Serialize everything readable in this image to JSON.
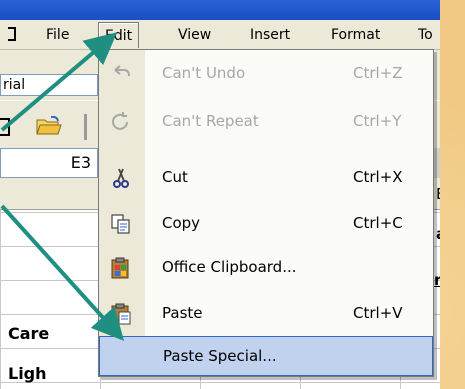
{
  "menubar": {
    "items": [
      {
        "id": "file",
        "label": "File",
        "u": "F"
      },
      {
        "id": "edit",
        "label": "Edit",
        "u": "E"
      },
      {
        "id": "view",
        "label": "View",
        "u": "V"
      },
      {
        "id": "insert",
        "label": "Insert",
        "u": "I"
      },
      {
        "id": "format",
        "label": "Format",
        "u": "o"
      },
      {
        "id": "tools",
        "label": "To",
        "u": ""
      }
    ]
  },
  "toolbar": {
    "font_name": "rial",
    "name_box": "E3"
  },
  "sheet": {
    "cells": [
      "Care",
      "Ligh"
    ],
    "right_fragments": [
      "E",
      "a",
      "rs"
    ]
  },
  "edit_menu": {
    "items": [
      {
        "label": "Can't Undo",
        "shortcut": "Ctrl+Z",
        "enabled": false,
        "icon": "undo-icon"
      },
      {
        "label": "Can't Repeat",
        "shortcut": "Ctrl+Y",
        "enabled": false,
        "icon": "repeat-icon"
      },
      {
        "label": "Cut",
        "shortcut": "Ctrl+X",
        "enabled": true,
        "icon": "scissors-icon"
      },
      {
        "label": "Copy",
        "shortcut": "Ctrl+C",
        "enabled": true,
        "icon": "copy-icon"
      },
      {
        "label": "Office Clipboard...",
        "shortcut": "",
        "enabled": true,
        "icon": "office-clipboard-icon"
      },
      {
        "label": "Paste",
        "shortcut": "Ctrl+V",
        "enabled": true,
        "icon": "paste-icon"
      },
      {
        "label": "Paste Special...",
        "shortcut": "",
        "enabled": true,
        "icon": "",
        "highlighted": true
      }
    ]
  },
  "colors": {
    "arrow": "#1f8f82",
    "highlight": "#c1d2ee",
    "highlight_border": "#316ac5",
    "disabled_text": "#a7a7a7"
  }
}
